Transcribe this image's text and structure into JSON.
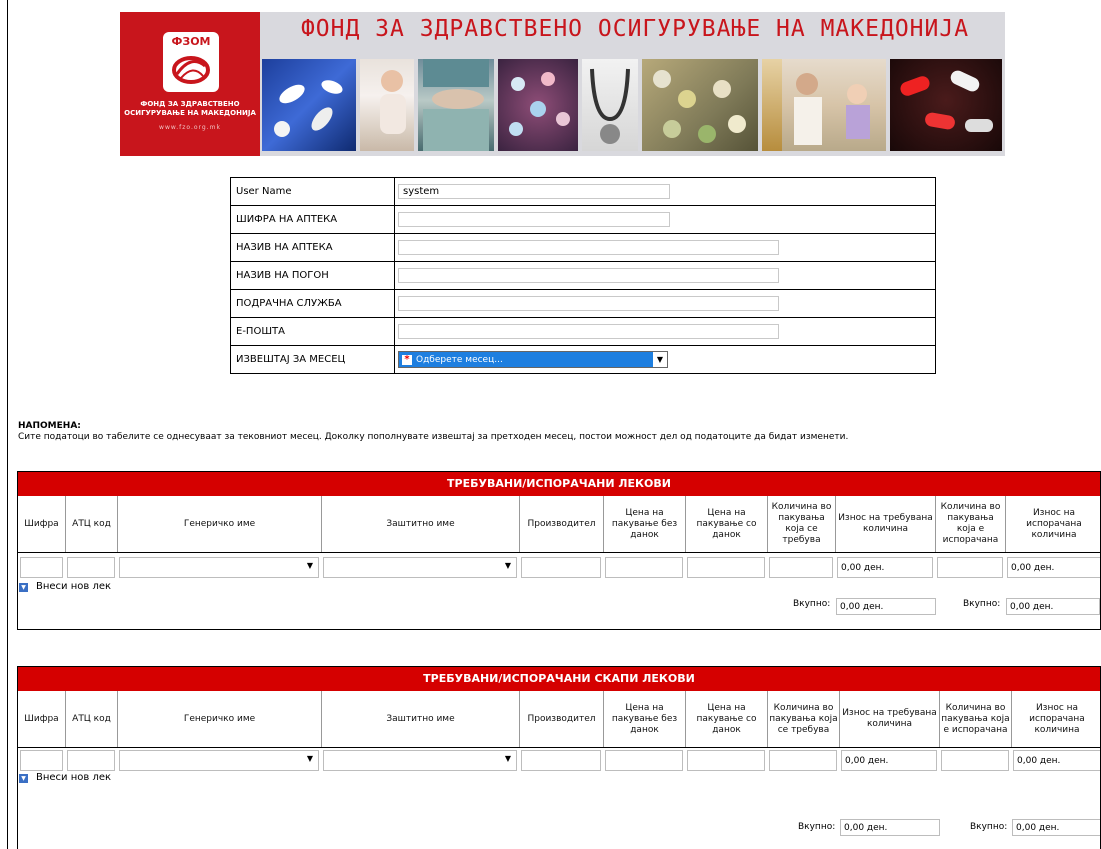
{
  "banner": {
    "title": "ФОНД ЗА ЗДРАВСТВЕНО ОСИГУРУВАЊЕ НА МАКЕДОНИЈА",
    "logo_abbr": "ФЗОМ",
    "logo_name": "ФОНД ЗА ЗДРАВСТВЕНО ОСИГУРУВАЊЕ НА МАКЕДОНИЈА",
    "logo_url": "www.fzo.org.mk",
    "brand_color": "#c8151c"
  },
  "form": {
    "fields": [
      {
        "label": "User Name",
        "value": "system"
      },
      {
        "label": "ШИФРА НА АПТЕКА",
        "value": ""
      },
      {
        "label": "НАЗИВ НА АПТЕКА",
        "value": ""
      },
      {
        "label": "НАЗИВ НА ПОГОН",
        "value": ""
      },
      {
        "label": "ПОДРАЧНА СЛУЖБА",
        "value": ""
      },
      {
        "label": "Е-ПОШТА",
        "value": ""
      }
    ],
    "month": {
      "label": "ИЗВЕШТАЈ ЗА МЕСЕЦ",
      "selected": "Одберете месец..."
    }
  },
  "note": {
    "title": "НАПОМЕНА:",
    "text": "Сите податоци во табелите се однесуваат за тековниот месец. Доколку пополнувате извештај за претходен месец, постои можност дел од податоците да бидат изменети."
  },
  "columns": [
    "Шифра",
    "АТЦ код",
    "Генеричко име",
    "Заштитно име",
    "Производител",
    "Цена на пакување без данок",
    "Цена на пакување со данок",
    "Количина во пакувања која се требува",
    "Износ на требувана количина",
    "Количина во пакувања која е испорачана",
    "Износ на испорачана количина"
  ],
  "tables": [
    {
      "title": "ТРЕБУВАНИ/ИСПОРАЧАНИ ЛЕКОВИ",
      "amount_requested": "0,00 ден.",
      "amount_delivered": "0,00 ден.",
      "add_label": "Внеси нов лек",
      "total_label": "Вкупно:",
      "total_requested": "0,00 ден.",
      "total_delivered": "0,00 ден."
    },
    {
      "title": "ТРЕБУВАНИ/ИСПОРАЧАНИ СКАПИ ЛЕКОВИ",
      "amount_requested": "0,00 ден.",
      "amount_delivered": "0,00 ден.",
      "add_label": "Внеси нов лек",
      "total_label": "Вкупно:",
      "total_requested": "0,00 ден.",
      "total_delivered": "0,00 ден."
    }
  ],
  "colors": {
    "header_red": "#d50000",
    "select_blue": "#1e7fe0"
  }
}
